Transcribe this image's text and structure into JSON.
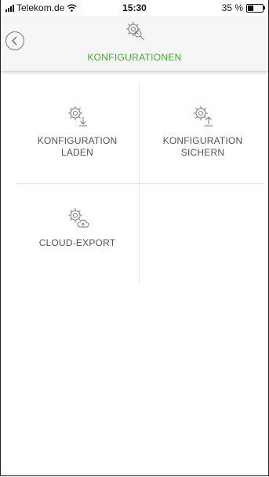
{
  "status_bar": {
    "carrier": "Telekom.de",
    "time": "15:30",
    "battery_text": "35 %",
    "battery_level": 0.35
  },
  "header": {
    "title": "KONFIGURATIONEN",
    "accent_color": "#45a831"
  },
  "tiles": [
    {
      "line1": "KONFIGURATION",
      "line2": "LADEN",
      "icon": "gear-download-icon"
    },
    {
      "line1": "KONFIGURATION",
      "line2": "SICHERN",
      "icon": "gear-upload-icon"
    },
    {
      "line1": "CLOUD-EXPORT",
      "line2": "",
      "icon": "gear-cloud-upload-icon"
    }
  ]
}
